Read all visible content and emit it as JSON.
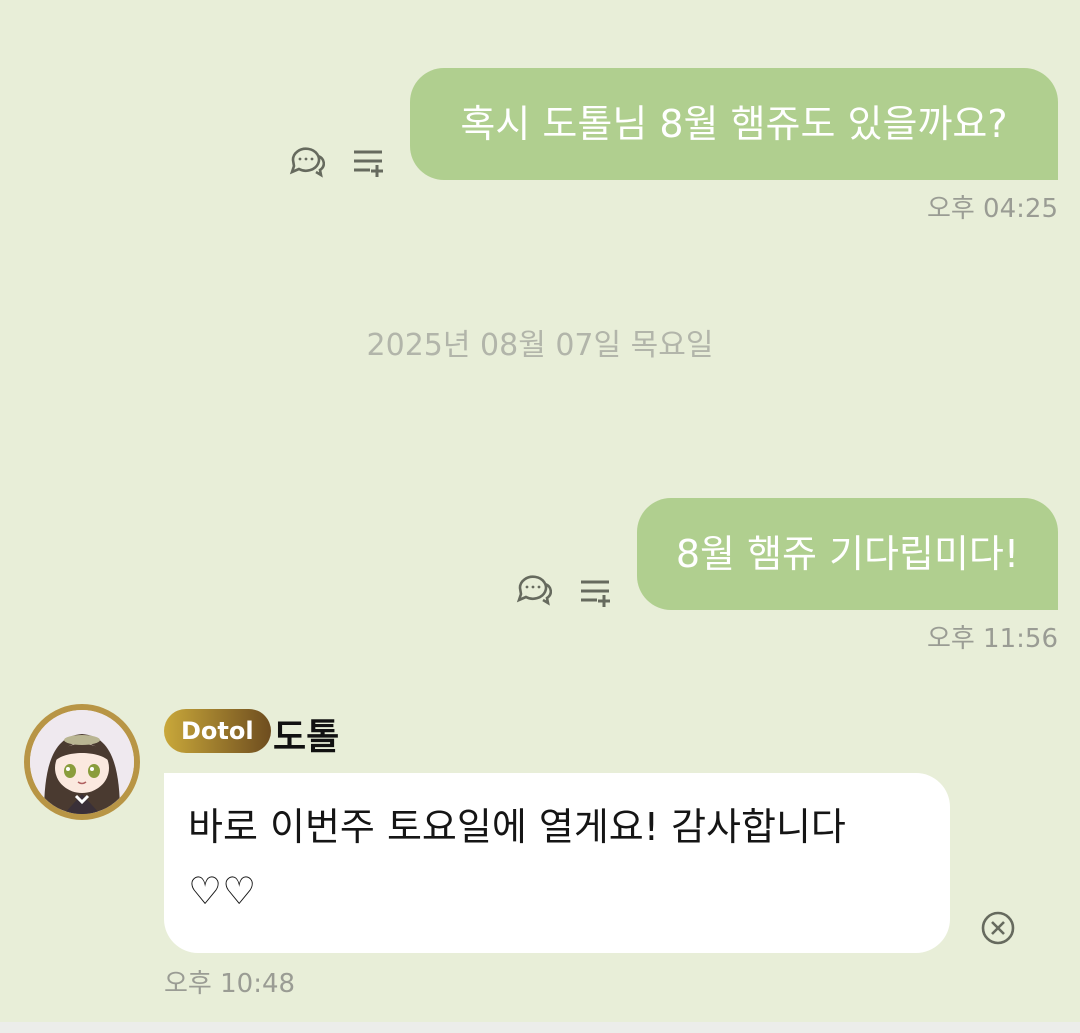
{
  "messages": [
    {
      "text": "혹시 도톨님 8월 햄쥬도 있을까요?",
      "time": "오후 04:25"
    },
    {
      "text": "8월 햄쥬 기다립미다!",
      "time": "오후 11:56"
    }
  ],
  "date_separator": "2025년 08월 07일 목요일",
  "incoming": {
    "badge": "Dotol",
    "sender": "도톨",
    "text_line1": "바로 이번주 토요일에 열게요! 감사합니다",
    "text_line2": "♡♡",
    "time": "오후 10:48"
  },
  "icons": {
    "reply": "comment-dots-icon",
    "add_to_list": "playlist-add-icon",
    "close": "close-circle-icon"
  },
  "colors": {
    "background": "#e8eed8",
    "outgoing_bubble": "#b0cf8f",
    "incoming_bubble": "#ffffff",
    "badge_gold": "#c9a83a"
  }
}
